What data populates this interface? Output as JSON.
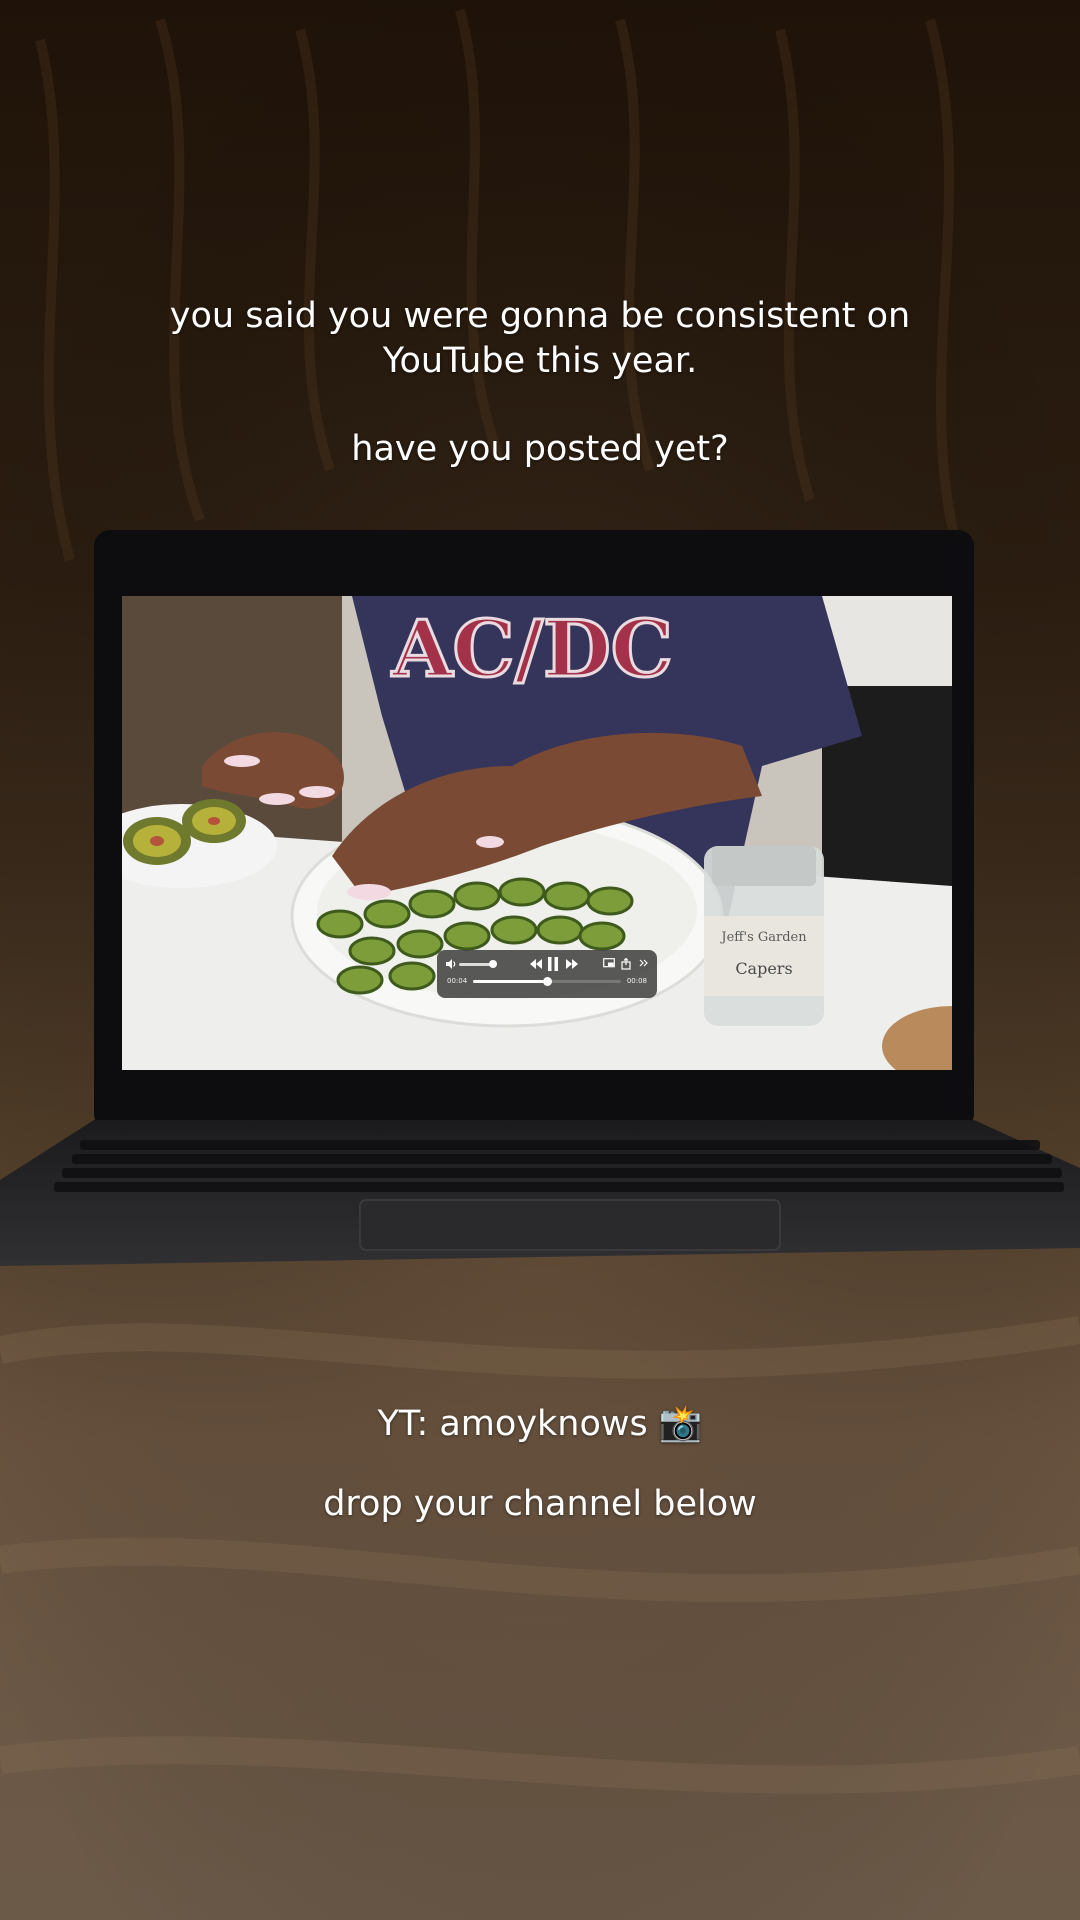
{
  "caption_top": {
    "line1": "you said you were gonna be consistent on",
    "line2": "YouTube this year.",
    "line3": "have you posted yet?"
  },
  "caption_bottom": {
    "line1": "YT: amoyknows 📸",
    "line2": "drop your channel below"
  },
  "video_player": {
    "time_current": "00:04",
    "time_total": "00:08",
    "progress": 0.5,
    "volume": 0.85,
    "icons": [
      "volume-icon",
      "rewind-icon",
      "pause-icon",
      "fast-forward-icon",
      "pip-icon",
      "share-icon",
      "expand-icon"
    ]
  },
  "scene": {
    "shirt_text": "AC/DC",
    "jar_label_brand": "Jeff's Garden",
    "jar_label_product": "Capers"
  }
}
